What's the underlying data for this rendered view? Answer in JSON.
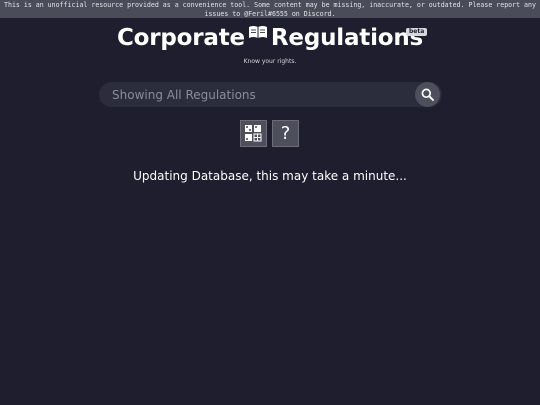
{
  "banner": {
    "text": "This is an unofficial resource provided as a convenience tool. Some content may be missing, inaccurate, or outdated. Please report any issues to @Feril#6555 on Discord."
  },
  "header": {
    "title_part1": "Corporate",
    "title_part2": "Regulations",
    "badge": "beta",
    "tagline": "Know your rights."
  },
  "search": {
    "placeholder": "Showing All Regulations",
    "value": ""
  },
  "tools": {
    "help_label": "?"
  },
  "status": {
    "message": "Updating Database, this may take a minute..."
  },
  "colors": {
    "background": "#1e1e2e",
    "banner": "#4a4c59",
    "search_bar": "#2c2d3c",
    "button": "#4d4f5c"
  },
  "icons": {
    "title": "open-book-icon",
    "search": "magnifier-icon",
    "layout": "grid-layout-icon"
  }
}
